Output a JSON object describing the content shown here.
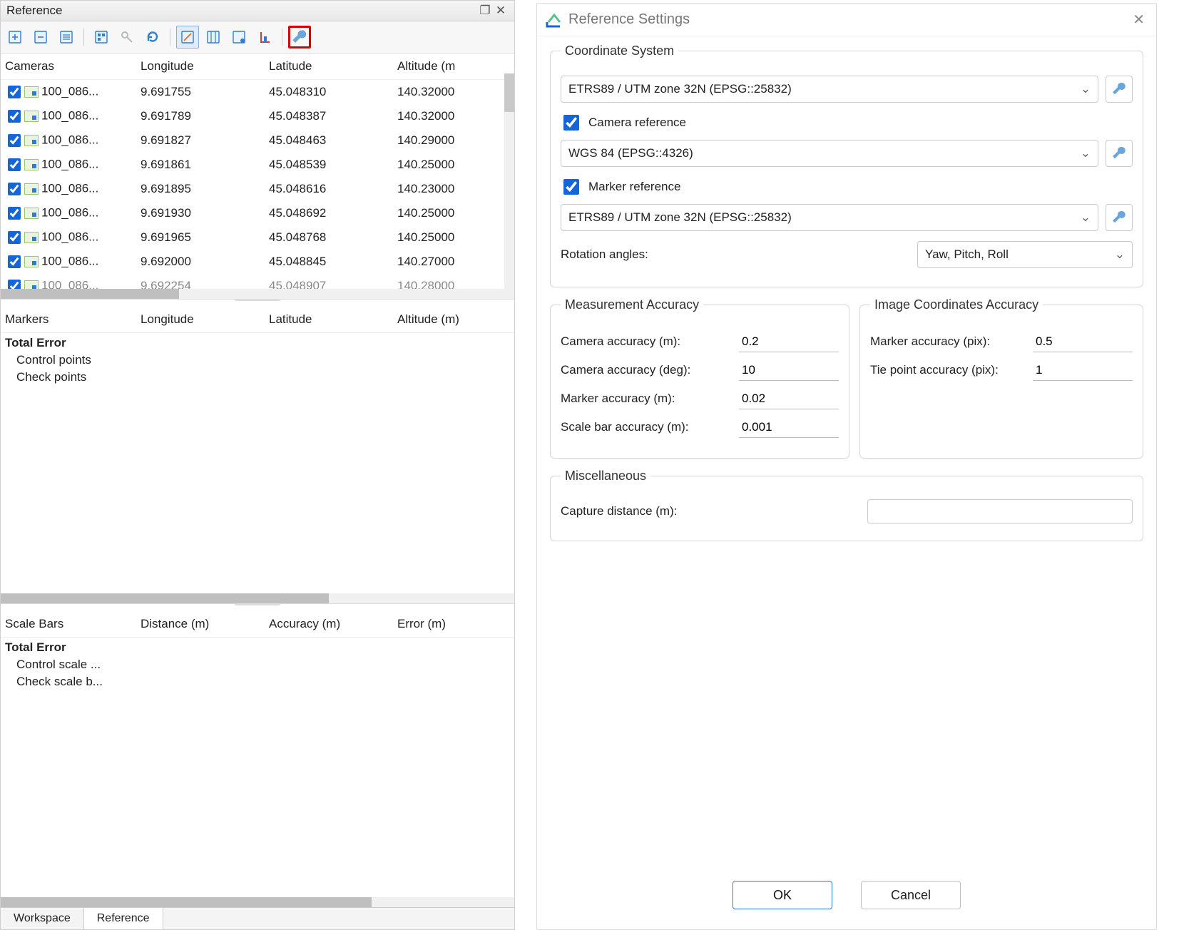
{
  "panel": {
    "title": "Reference",
    "columns_cameras": [
      "Cameras",
      "Longitude",
      "Latitude",
      "Altitude (m"
    ],
    "camera_rows": [
      {
        "name": "100_086...",
        "lon": "9.691755",
        "lat": "45.048310",
        "alt": "140.32000",
        "faded": false
      },
      {
        "name": "100_086...",
        "lon": "9.691789",
        "lat": "45.048387",
        "alt": "140.32000",
        "faded": false
      },
      {
        "name": "100_086...",
        "lon": "9.691827",
        "lat": "45.048463",
        "alt": "140.29000",
        "faded": false
      },
      {
        "name": "100_086...",
        "lon": "9.691861",
        "lat": "45.048539",
        "alt": "140.25000",
        "faded": false
      },
      {
        "name": "100_086...",
        "lon": "9.691895",
        "lat": "45.048616",
        "alt": "140.23000",
        "faded": false
      },
      {
        "name": "100_086...",
        "lon": "9.691930",
        "lat": "45.048692",
        "alt": "140.25000",
        "faded": false
      },
      {
        "name": "100_086...",
        "lon": "9.691965",
        "lat": "45.048768",
        "alt": "140.25000",
        "faded": false
      },
      {
        "name": "100_086...",
        "lon": "9.692000",
        "lat": "45.048845",
        "alt": "140.27000",
        "faded": false
      },
      {
        "name": "100_086...",
        "lon": "9.692254",
        "lat": "45.048907",
        "alt": "140.28000",
        "faded": true
      }
    ],
    "markers": {
      "columns": [
        "Markers",
        "Longitude",
        "Latitude",
        "Altitude (m)"
      ],
      "total_error": "Total Error",
      "control": "Control points",
      "check": "Check points"
    },
    "scalebars": {
      "columns": [
        "Scale Bars",
        "Distance (m)",
        "Accuracy (m)",
        "Error (m)"
      ],
      "total_error": "Total Error",
      "control": "Control scale ...",
      "check": "Check scale b..."
    },
    "tabs": {
      "workspace": "Workspace",
      "reference": "Reference"
    }
  },
  "dialog": {
    "title": "Reference Settings",
    "cs_legend": "Coordinate System",
    "cs_main": "ETRS89 / UTM zone 32N (EPSG::25832)",
    "camera_ref_label": "Camera reference",
    "camera_ref_value": "WGS 84 (EPSG::4326)",
    "marker_ref_label": "Marker reference",
    "marker_ref_value": "ETRS89 / UTM zone 32N (EPSG::25832)",
    "rotation_label": "Rotation angles:",
    "rotation_value": "Yaw, Pitch, Roll",
    "meas_legend": "Measurement Accuracy",
    "meas": {
      "camera_m_label": "Camera accuracy (m):",
      "camera_m": "0.2",
      "camera_deg_label": "Camera accuracy (deg):",
      "camera_deg": "10",
      "marker_m_label": "Marker accuracy (m):",
      "marker_m": "0.02",
      "scalebar_m_label": "Scale bar accuracy (m):",
      "scalebar_m": "0.001"
    },
    "img_legend": "Image Coordinates Accuracy",
    "img": {
      "marker_pix_label": "Marker accuracy (pix):",
      "marker_pix": "0.5",
      "tie_pix_label": "Tie point accuracy (pix):",
      "tie_pix": "1"
    },
    "misc_legend": "Miscellaneous",
    "capture_label": "Capture distance (m):",
    "capture_value": "",
    "ok": "OK",
    "cancel": "Cancel"
  }
}
